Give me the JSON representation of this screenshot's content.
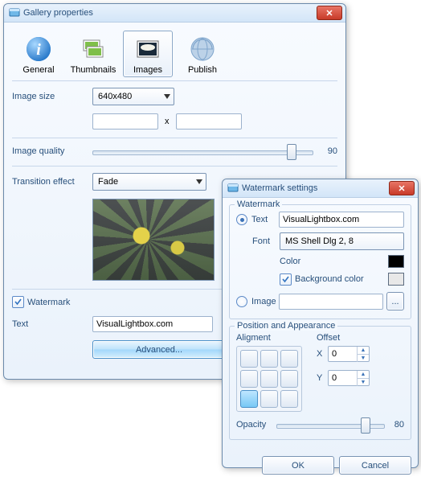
{
  "win1": {
    "title": "Gallery properties",
    "tabs": {
      "general": "General",
      "thumbnails": "Thumbnails",
      "images": "Images",
      "publish": "Publish"
    },
    "labels": {
      "image_size": "Image size",
      "x": "x",
      "image_quality": "Image quality",
      "transition": "Transition effect",
      "watermark": "Watermark",
      "text": "Text"
    },
    "image_size_value": "640x480",
    "quality_value": "90",
    "transition_value": "Fade",
    "text_value": "VisualLightbox.com",
    "advanced_btn": "Advanced..."
  },
  "win2": {
    "title": "Watermark settings",
    "group_watermark": "Watermark",
    "group_pos": "Position and Appearance",
    "radio_text": "Text",
    "text_value": "VisualLightbox.com",
    "font_label": "Font",
    "font_value": "MS Shell Dlg 2, 8",
    "color_label": "Color",
    "bg_label": "Background color",
    "radio_image": "Image",
    "browse_btn": "...",
    "align_label": "Aligment",
    "offset_label": "Offset",
    "x_label": "X",
    "y_label": "Y",
    "x_value": "0",
    "y_value": "0",
    "opacity_label": "Opacity",
    "opacity_value": "80",
    "ok_btn": "OK",
    "cancel_btn": "Cancel"
  }
}
